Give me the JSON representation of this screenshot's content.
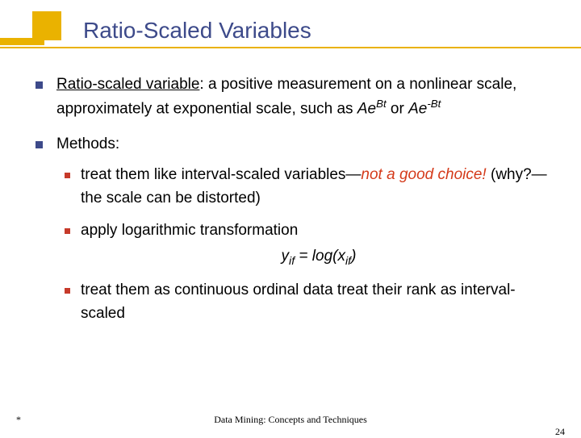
{
  "title": "Ratio-Scaled Variables",
  "bullets": {
    "b1": {
      "term": "Ratio-scaled variable",
      "rest": ": a positive measurement on a nonlinear scale, approximately at exponential scale, such as ",
      "expA_base": "Ae",
      "expA_sup": "Bt",
      "or": " or ",
      "expB_base": "Ae",
      "expB_sup": "-Bt"
    },
    "b2": "Methods:",
    "sub": {
      "s1a": "treat them like interval-scaled variables—",
      "s1warn": "not a good choice!",
      "s1b": " (why?—the scale can be distorted)",
      "s2": "apply logarithmic transformation",
      "formula_left": "y",
      "formula_sub1": "if",
      "formula_mid": " = log(x",
      "formula_sub2": "if",
      "formula_right": ")",
      "s3": "treat them as continuous ordinal data treat their rank as interval-scaled"
    }
  },
  "footer": {
    "left": "*",
    "center": "Data Mining: Concepts and Techniques",
    "page": "24"
  }
}
